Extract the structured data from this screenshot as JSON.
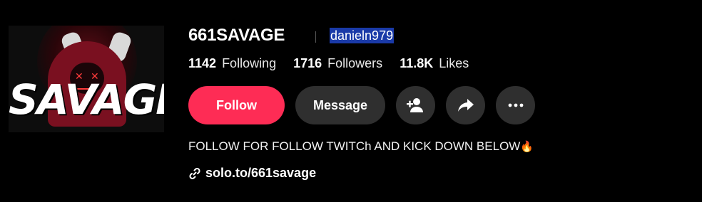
{
  "avatar": {
    "logo_text": "SAVAGE"
  },
  "profile": {
    "username": "661SAVAGE",
    "nickname": "danieln979"
  },
  "stats": [
    {
      "count": "1142",
      "label": "Following"
    },
    {
      "count": "1716",
      "label": "Followers"
    },
    {
      "count": "11.8K",
      "label": "Likes"
    }
  ],
  "actions": {
    "follow_label": "Follow",
    "message_label": "Message",
    "add_friend_icon": "add-user-icon",
    "share_icon": "share-icon",
    "more_icon": "more-icon"
  },
  "bio": {
    "text": "FOLLOW FOR FOLLOW TWITCh AND KICK DOWN BELOW",
    "emoji": "🔥"
  },
  "link": {
    "text": "solo.to/661savage",
    "icon": "link-icon"
  },
  "colors": {
    "background": "#000000",
    "follow": "#fe2c55",
    "secondary_button": "#2f2f2f",
    "selection": "#1a3aa8"
  }
}
